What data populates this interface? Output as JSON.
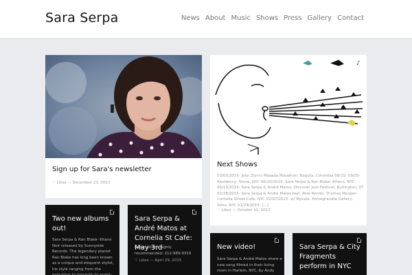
{
  "site": {
    "title": "Sara Serpa"
  },
  "nav": [
    "News",
    "About",
    "Music",
    "Shows",
    "Press",
    "Gallery",
    "Contact"
  ],
  "posts": [
    {
      "title": "Sign up for Sara's newsletter",
      "likes": "Likes",
      "date": "— December 23, 2013"
    },
    {
      "title": "Next Shows",
      "excerpt": "10/03/2015- John Zorn's Masada Marathon, Bogota, Colombia 09/15- 09/20- Residency- Stone, NYC 06/20/2015- Sara Serpa & Ran Blake- Kitano, NYC 06/13/2015- Sara Serpa & André Matos- Discover Jazz Festival, Burlington, VT 02/28/2015- Sara Serpa & André Matos feat. Pete Rende, Thomas Morgan- Cornelia Street Cafe, NYC 02/07/2015- w/ Mycale- Pomegranate Gallery, Soho, NYC 01/29/2015- [...]",
      "likes": "Likes",
      "date": "— October 31, 2013"
    },
    {
      "title": "Two new albums out!",
      "excerpt": "Sara Serpa & Ran Blake- Kitano Noir released by Sunnyside Records. The legendary pianist Ran Blake has long been known as a unique and eloquent stylist, his style ranging from the evocative to romantic to avant-garde. He is also"
    },
    {
      "title": "Sara Serpa & André Matos at Cornelia St Cafe: May 3rd",
      "excerpt": "Reservations highly recommended: 212-989-9319",
      "likes": "Likes",
      "date": "— April 29, 2015"
    },
    {
      "title": "New video!",
      "excerpt": "Sara Serpa & André Matos share a new song filmed in their living room in Harlem, NYC, by Andy LaViolette."
    },
    {
      "title": "Sara Serpa & City Fragments perform in NYC"
    }
  ],
  "colors": {
    "background": "#e9ebee",
    "header": "#ffffff",
    "dark_card": "#111111"
  }
}
